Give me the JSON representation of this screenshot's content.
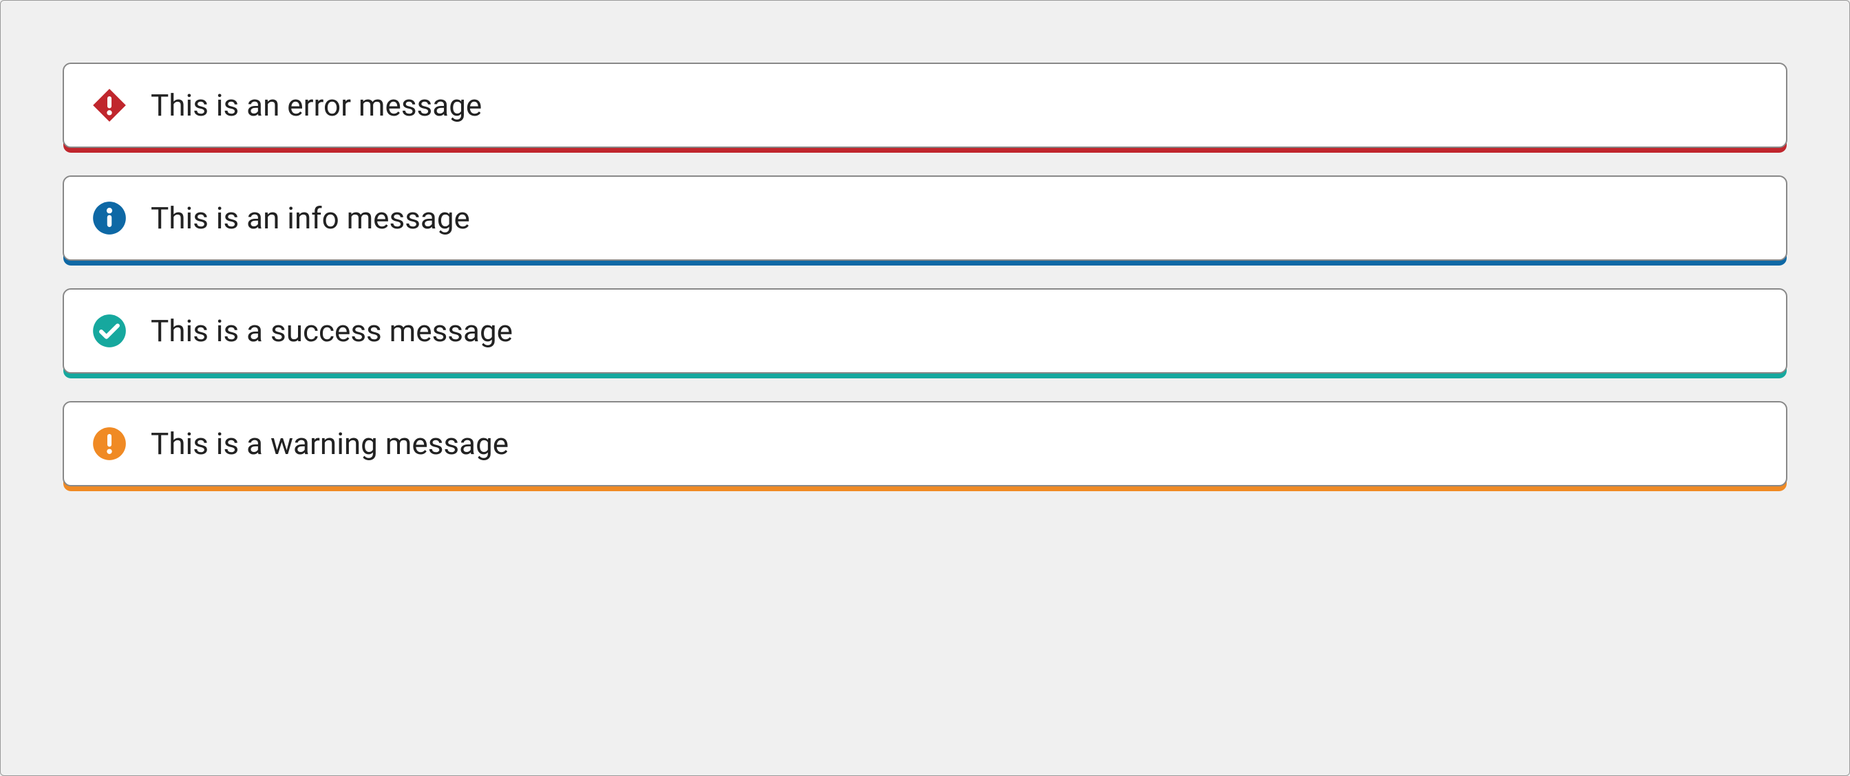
{
  "alerts": [
    {
      "type": "error",
      "text": "This is an error message",
      "color": "#c0262d"
    },
    {
      "type": "info",
      "text": "This is an info message",
      "color": "#0e68a5"
    },
    {
      "type": "success",
      "text": "This is a success message",
      "color": "#16a89e"
    },
    {
      "type": "warning",
      "text": "This is a warning message",
      "color": "#f08a24"
    }
  ]
}
